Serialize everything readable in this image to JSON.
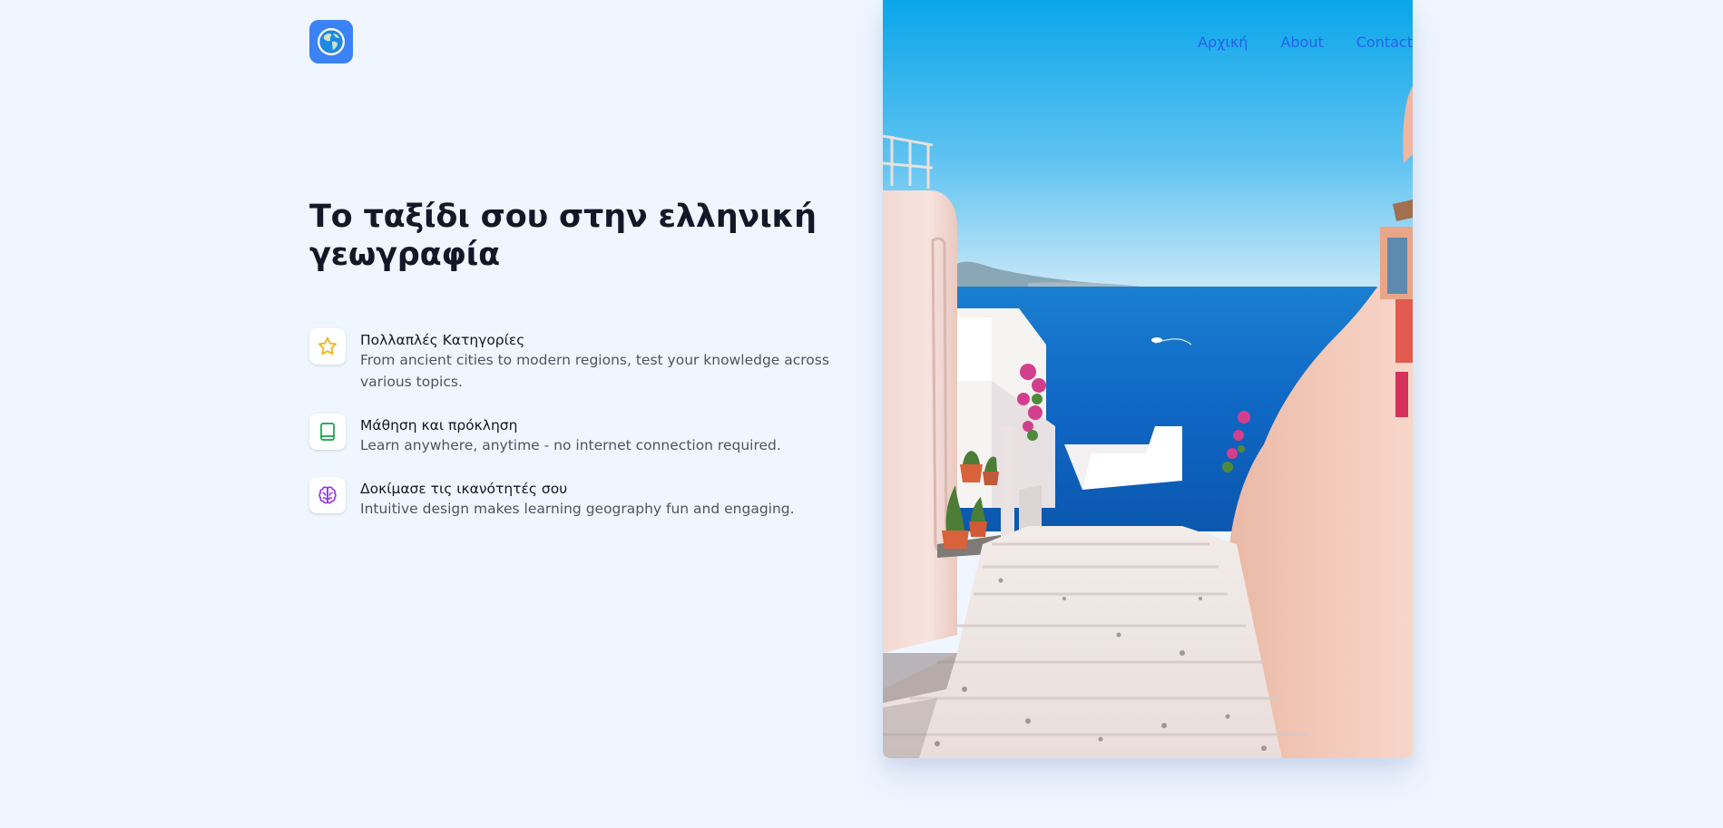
{
  "brand": {
    "logo_icon": "globe-icon",
    "logo_bg": "#3b82f6"
  },
  "nav": {
    "items": [
      {
        "label": "Αρχική"
      },
      {
        "label": "About"
      },
      {
        "label": "Contact"
      }
    ],
    "color": "#2563eb"
  },
  "hero": {
    "title": "Το ταξίδι σου στην ελληνική γεωγραφία"
  },
  "features": [
    {
      "icon": "star-icon",
      "icon_color": "#eab308",
      "title": "Πολλαπλές Κατηγορίες",
      "description": "From ancient cities to modern regions, test your knowledge across various topics."
    },
    {
      "icon": "book-icon",
      "icon_color": "#16a34a",
      "title": "Μάθηση και πρόκληση",
      "description": "Learn anywhere, anytime - no internet connection required."
    },
    {
      "icon": "brain-icon",
      "icon_color": "#9333ea",
      "title": "Δοκίμασε τις ικανότητές σου",
      "description": "Intuitive design makes learning geography fun and engaging."
    }
  ],
  "photo": {
    "subject": "santorini-stairway-photo"
  }
}
